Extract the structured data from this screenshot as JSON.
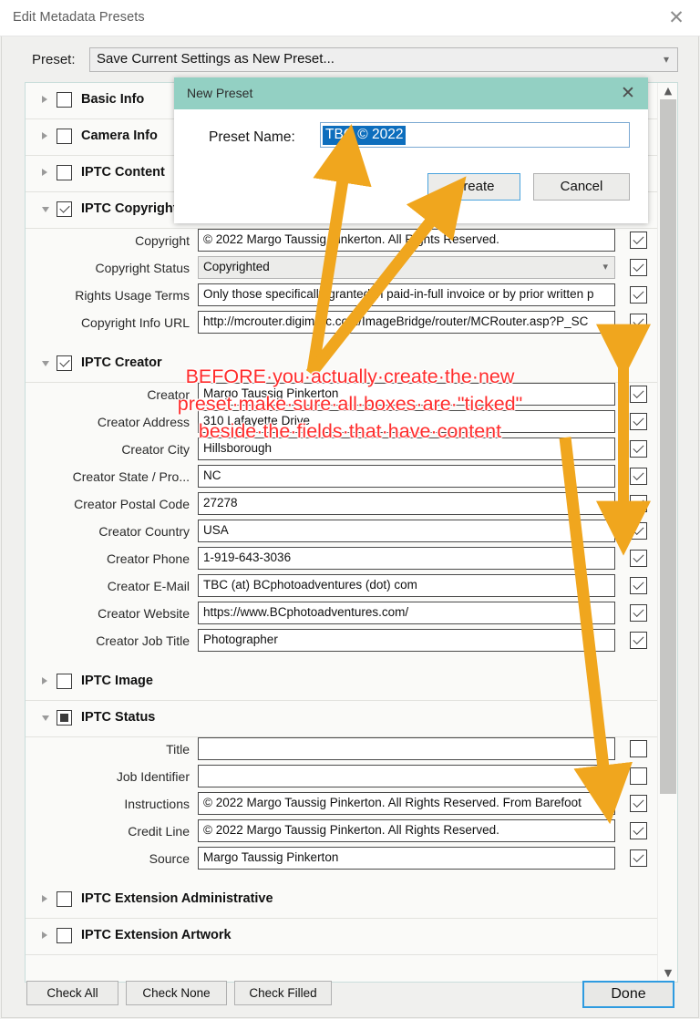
{
  "window": {
    "title": "Edit Metadata Presets",
    "close_icon": "close-icon"
  },
  "preset": {
    "label": "Preset:",
    "value": "Save Current Settings as New Preset...",
    "chevron": "⌄"
  },
  "sections": [
    {
      "id": "basic-info",
      "label": "Basic Info",
      "expanded": false,
      "checkbox": "unchecked"
    },
    {
      "id": "camera-info",
      "label": "Camera Info",
      "expanded": false,
      "checkbox": "unchecked"
    },
    {
      "id": "iptc-content",
      "label": "IPTC Content",
      "expanded": false,
      "checkbox": "unchecked"
    },
    {
      "id": "iptc-copyright",
      "label": "IPTC Copyright",
      "expanded": true,
      "checkbox": "checked"
    },
    {
      "id": "iptc-creator",
      "label": "IPTC Creator",
      "expanded": true,
      "checkbox": "checked"
    },
    {
      "id": "iptc-image",
      "label": "IPTC Image",
      "expanded": false,
      "checkbox": "unchecked"
    },
    {
      "id": "iptc-status",
      "label": "IPTC Status",
      "expanded": true,
      "checkbox": "partial"
    },
    {
      "id": "iptc-ext-admin",
      "label": "IPTC Extension Administrative",
      "expanded": false,
      "checkbox": "unchecked"
    },
    {
      "id": "iptc-ext-artwork",
      "label": "IPTC Extension Artwork",
      "expanded": false,
      "checkbox": "unchecked"
    }
  ],
  "copyright_fields": [
    {
      "label": "Copyright",
      "value": "© 2022 Margo Taussig Pinkerton.  All Rights Reserved.",
      "checked": true,
      "type": "text"
    },
    {
      "label": "Copyright Status",
      "value": "Copyrighted",
      "checked": true,
      "type": "combo"
    },
    {
      "label": "Rights Usage Terms",
      "value": "Only those specifically granted in paid-in-full invoice or by prior written p",
      "checked": true,
      "type": "text"
    },
    {
      "label": "Copyright Info URL",
      "value": "http://mcrouter.digimarc.com/ImageBridge/router/MCRouter.asp?P_SC",
      "checked": true,
      "type": "text"
    }
  ],
  "creator_fields": [
    {
      "label": "Creator",
      "value": "Margo Taussig Pinkerton",
      "checked": true,
      "type": "text"
    },
    {
      "label": "Creator Address",
      "value": "310 Lafayette Drive",
      "checked": true,
      "type": "text"
    },
    {
      "label": "Creator City",
      "value": "Hillsborough",
      "checked": true,
      "type": "text"
    },
    {
      "label": "Creator State / Pro...",
      "value": "NC",
      "checked": true,
      "type": "text"
    },
    {
      "label": "Creator Postal Code",
      "value": "27278",
      "checked": true,
      "type": "text"
    },
    {
      "label": "Creator Country",
      "value": "USA",
      "checked": true,
      "type": "text"
    },
    {
      "label": "Creator Phone",
      "value": "1-919-643-3036",
      "checked": true,
      "type": "text"
    },
    {
      "label": "Creator E-Mail",
      "value": "TBC (at) BCphotoadventures (dot) com",
      "checked": true,
      "type": "text"
    },
    {
      "label": "Creator Website",
      "value": "https://www.BCphotoadventures.com/",
      "checked": true,
      "type": "text"
    },
    {
      "label": "Creator Job Title",
      "value": "Photographer",
      "checked": true,
      "type": "text"
    }
  ],
  "status_fields": [
    {
      "label": "Title",
      "value": "",
      "checked": false,
      "type": "text"
    },
    {
      "label": "Job Identifier",
      "value": "",
      "checked": false,
      "type": "text"
    },
    {
      "label": "Instructions",
      "value": "© 2022 Margo Taussig Pinkerton.  All Rights Reserved.  From Barefoot",
      "checked": true,
      "type": "text"
    },
    {
      "label": "Credit Line",
      "value": "© 2022 Margo Taussig Pinkerton.  All Rights Reserved.",
      "checked": true,
      "type": "text"
    },
    {
      "label": "Source",
      "value": "Margo Taussig Pinkerton",
      "checked": true,
      "type": "text"
    }
  ],
  "footer": {
    "check_all": "Check All",
    "check_none": "Check None",
    "check_filled": "Check Filled",
    "done": "Done"
  },
  "modal": {
    "title": "New Preset",
    "close_icon": "close-icon",
    "name_label": "Preset Name:",
    "name_value": "TBC © 2022",
    "create": "Create",
    "cancel": "Cancel"
  },
  "annotation": {
    "line1": "BEFORE·you·actually·create·the·new",
    "line2": "preset·make·sure·all·boxes·are·\"ticked\"",
    "line3": "beside·the·fields·that·have·content",
    "color": "#ff2d2d",
    "arrow_color": "#f0a61e"
  }
}
